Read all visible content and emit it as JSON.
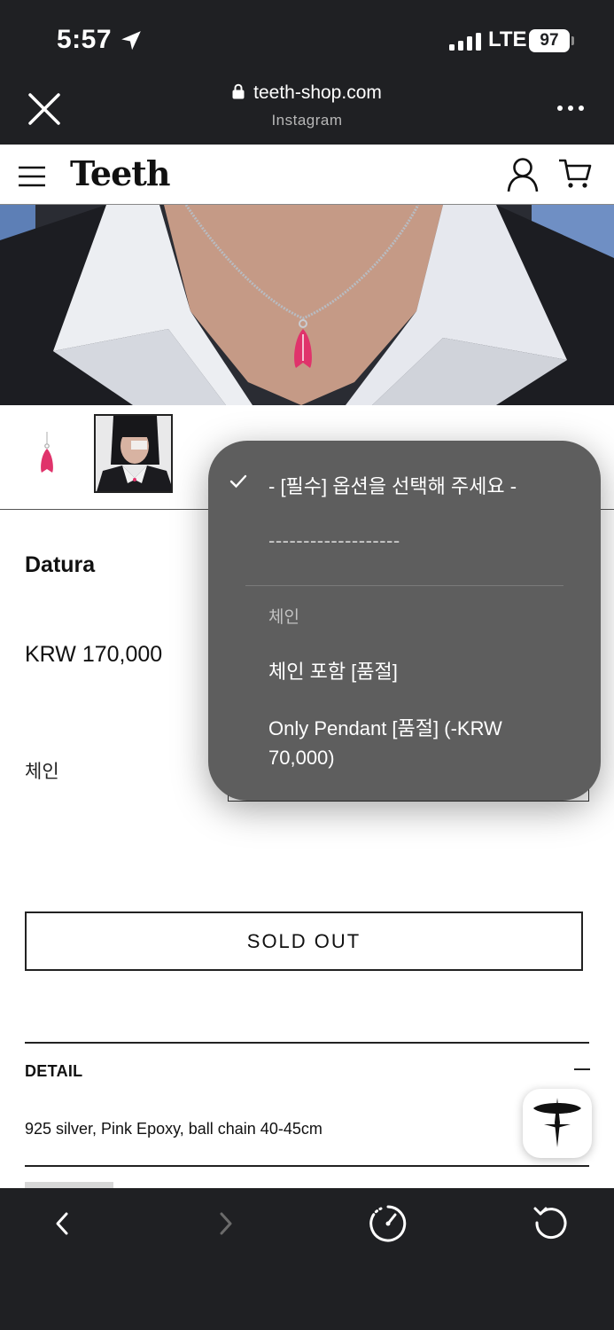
{
  "status_bar": {
    "time": "5:57",
    "network": "LTE",
    "battery": "97"
  },
  "browser": {
    "url": "teeth-shop.com",
    "source": "Instagram"
  },
  "site": {
    "logo": "Teeth"
  },
  "product": {
    "name": "Datura",
    "price": "KRW 170,000",
    "option_label": "체인",
    "sold_out_label": "SOLD OUT",
    "detail_title": "DETAIL",
    "detail_text": "925 silver, Pink Epoxy, ball chain 40-45cm"
  },
  "option_popup": {
    "selected": "- [필수] 옵션을 선택해 주세요 -",
    "separator": "-------------------",
    "group_label": "체인",
    "options": [
      "체인 포함 [품절]",
      "Only Pendant [품절] (-KRW 70,000)"
    ]
  },
  "colors": {
    "chrome_bg": "#1f2023",
    "popup_bg": "#5e5e5e",
    "pendant_pink": "#e0336b"
  }
}
